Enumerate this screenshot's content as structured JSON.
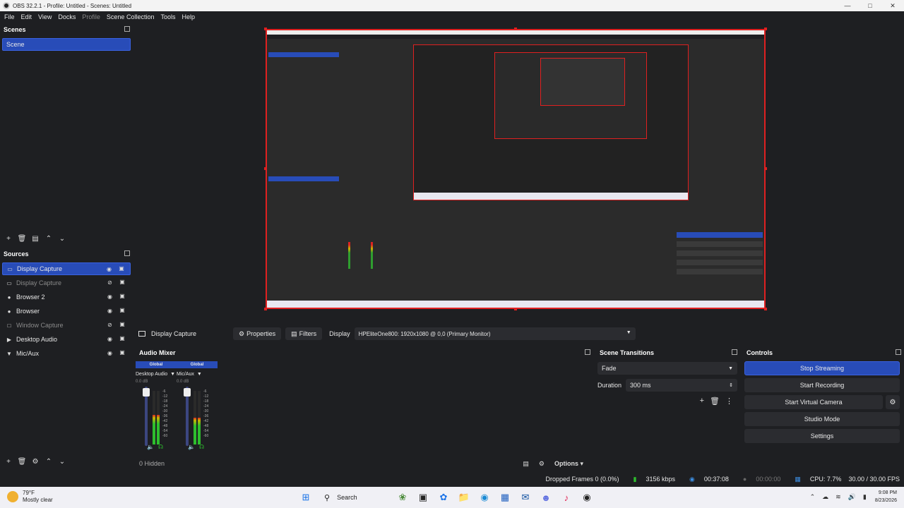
{
  "window": {
    "title": "OBS 32.2.1 - Profile: Untitled - Scenes: Untitled"
  },
  "menu": [
    "File",
    "Edit",
    "View",
    "Docks",
    "Profile",
    "Scene Collection",
    "Tools",
    "Help"
  ],
  "menu_disabled": [
    "Profile"
  ],
  "scenes": {
    "title": "Scenes",
    "items": [
      "Scene"
    ]
  },
  "sources": {
    "title": "Sources",
    "items": [
      {
        "label": "Display Capture",
        "icon": "monitor-icon",
        "visible": true,
        "active": true
      },
      {
        "label": "Display Capture",
        "icon": "monitor-icon",
        "visible": false,
        "active": false
      },
      {
        "label": "Browser 2",
        "icon": "globe-icon",
        "visible": true,
        "active": false
      },
      {
        "label": "Browser",
        "icon": "globe-icon",
        "visible": true,
        "active": false
      },
      {
        "label": "Window Capture",
        "icon": "window-icon",
        "visible": false,
        "active": false
      },
      {
        "label": "Desktop Audio",
        "icon": "speaker-icon",
        "visible": true,
        "active": false
      },
      {
        "label": "Mic/Aux",
        "icon": "mic-icon",
        "visible": true,
        "active": false
      }
    ]
  },
  "context": {
    "source_name": "Display Capture",
    "properties_label": "Properties",
    "filters_label": "Filters",
    "display_label": "Display",
    "display_value": "HPEliteOne800: 1920x1080 @ 0,0 (Primary Monitor)"
  },
  "mixer": {
    "title": "Audio Mixer",
    "channels": [
      {
        "badge": "Global",
        "name": "Desktop Audio",
        "db": "0.0 dB",
        "level": 0.55
      },
      {
        "badge": "Global",
        "name": "Mic/Aux",
        "db": "0.0 dB",
        "level": 0.5
      }
    ],
    "scale": [
      "-6",
      "-12",
      "-18",
      "-24",
      "-30",
      "-36",
      "-42",
      "-48",
      "-54",
      "-60"
    ],
    "hidden_label": "0 Hidden",
    "options_label": "Options"
  },
  "transitions": {
    "title": "Scene Transitions",
    "selected": "Fade",
    "duration_label": "Duration",
    "duration_value": "300 ms"
  },
  "controls": {
    "title": "Controls",
    "buttons": [
      "Stop Streaming",
      "Start Recording",
      "Start Virtual Camera",
      "Studio Mode",
      "Settings"
    ]
  },
  "status": {
    "dropped": "Dropped Frames 0 (0.0%)",
    "bitrate": "3156 kbps",
    "stream_time": "00:37:08",
    "rec_time": "00:00:00",
    "cpu": "CPU: 7.7%",
    "fps": "30.00 / 30.00 FPS"
  },
  "taskbar": {
    "temp": "79°F",
    "weather": "Mostly clear",
    "search_label": "Search",
    "time": "9:08 PM",
    "date": "8/23/2026"
  },
  "colors": {
    "accent": "#284cb8",
    "preview_border": "#e02020",
    "meter_green": "#2dbf2d"
  }
}
